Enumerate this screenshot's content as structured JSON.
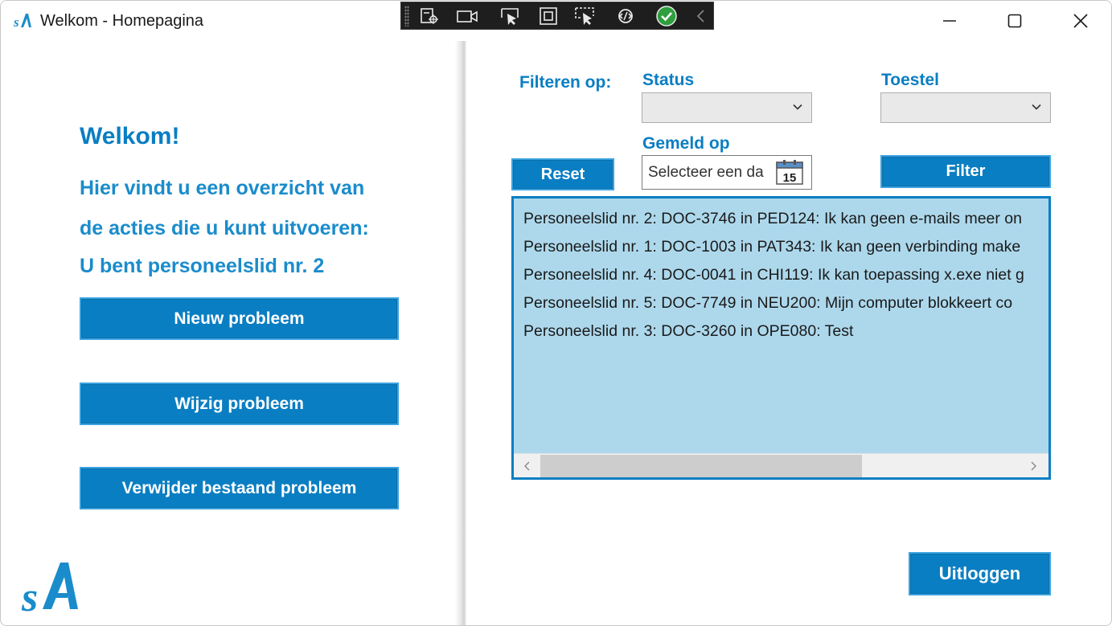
{
  "window": {
    "title": "Welkom - Homepagina",
    "minimize_icon": "minimize-icon",
    "maximize_icon": "maximize-icon",
    "close_icon": "close-icon"
  },
  "debug_toolbar": {
    "icons": [
      "live-visual-tree-icon",
      "video-camera-icon",
      "select-element-icon",
      "display-layout-adorners-icon",
      "track-focus-icon",
      "hot-reload-icon",
      "checkmark-icon",
      "collapse-chevron-icon"
    ]
  },
  "welcome": {
    "title": "Welkom!",
    "line1": "Hier vindt u een overzicht van",
    "line2": "de acties die u kunt uitvoeren:",
    "line3": "U bent personeelslid nr. 2"
  },
  "actions": {
    "new_label": "Nieuw probleem",
    "edit_label": "Wijzig probleem",
    "delete_label": "Verwijder bestaand probleem"
  },
  "filters": {
    "filter_on_label": "Filteren op:",
    "status_label": "Status",
    "status_value": "",
    "device_label": "Toestel",
    "device_value": "",
    "reported_label": "Gemeld op",
    "date_placeholder": "Selecteer een da",
    "calendar_day": "15",
    "reset_label": "Reset",
    "filter_label": "Filter"
  },
  "problems": {
    "items": [
      "Personeelslid nr. 2: DOC-3746 in PED124: Ik kan geen e-mails meer on",
      "Personeelslid nr. 1: DOC-1003 in PAT343: Ik kan geen verbinding make",
      "Personeelslid nr. 4: DOC-0041 in CHI119: Ik kan toepassing x.exe niet g",
      "Personeelslid nr. 5: DOC-7749 in NEU200: Mijn computer blokkeert co",
      "Personeelslid nr. 3: DOC-3260 in OPE080: Test"
    ]
  },
  "logout_label": "Uitloggen",
  "colors": {
    "accent": "#0a7ec2",
    "list_background": "#add8ec",
    "debug_toolbar": "#1e1e1e",
    "success": "#2e9e3e"
  }
}
